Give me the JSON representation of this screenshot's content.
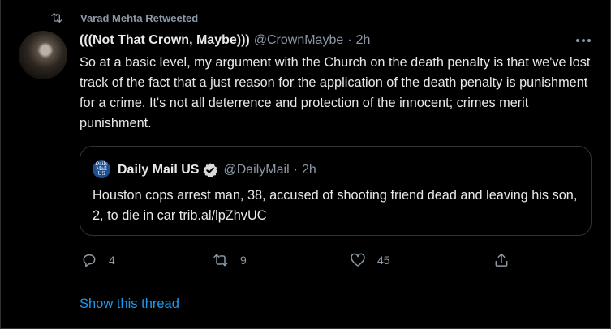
{
  "social_context": {
    "text": "Varad Mehta Retweeted",
    "icon": "retweet-icon"
  },
  "tweet": {
    "author_name": "(((Not That Crown, Maybe)))",
    "author_handle": "@CrownMaybe",
    "separator": "·",
    "time": "2h",
    "text": "So at a basic level, my argument with the Church on the death penalty is that we've lost track of the fact that a just reason for the application of the death penalty is punishment for a crime. It's not all deterrence and protection of the innocent; crimes merit punishment."
  },
  "quoted_tweet": {
    "avatar_text": "Daily Mail US",
    "author_name": "Daily Mail US",
    "verified": true,
    "author_handle": "@DailyMail",
    "separator": "·",
    "time": "2h",
    "text": "Houston cops arrest man, 38, accused of shooting friend dead and leaving his son, 2, to die in car trib.al/lpZhvUC"
  },
  "actions": {
    "reply_count": "4",
    "retweet_count": "9",
    "like_count": "45"
  },
  "show_thread": "Show this thread",
  "colors": {
    "background": "#000000",
    "text_primary": "#e7e9ea",
    "text_secondary": "#8b98a5",
    "link": "#1d9bf0",
    "verified": "#d9d9d9",
    "border": "#2f3336"
  }
}
